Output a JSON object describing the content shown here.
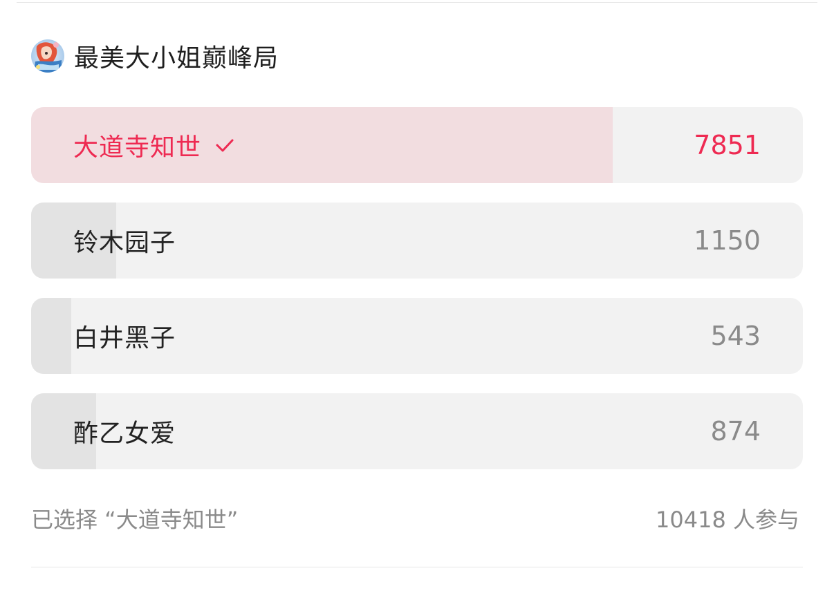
{
  "poll": {
    "title": "最美大小姐巅峰局",
    "avatar_icon": "anime-character-avatar"
  },
  "options": [
    {
      "label": "大道寺知世",
      "votes": "7851",
      "share": 0.7536,
      "selected": true
    },
    {
      "label": "铃木园子",
      "votes": "1150",
      "share": 0.1104,
      "selected": false
    },
    {
      "label": "白井黑子",
      "votes": "543",
      "share": 0.0521,
      "selected": false
    },
    {
      "label": "酢乙女爱",
      "votes": "874",
      "share": 0.0839,
      "selected": false
    }
  ],
  "footer": {
    "selection_text": "已选择 “大道寺知世”",
    "participants_text": "10418 人参与"
  },
  "colors": {
    "accent": "#ee2a52",
    "selected_fill": "#f2dde0",
    "bar_fill": "#e3e3e3",
    "track": "#f2f2f2",
    "muted_text": "#8a8a8a"
  }
}
